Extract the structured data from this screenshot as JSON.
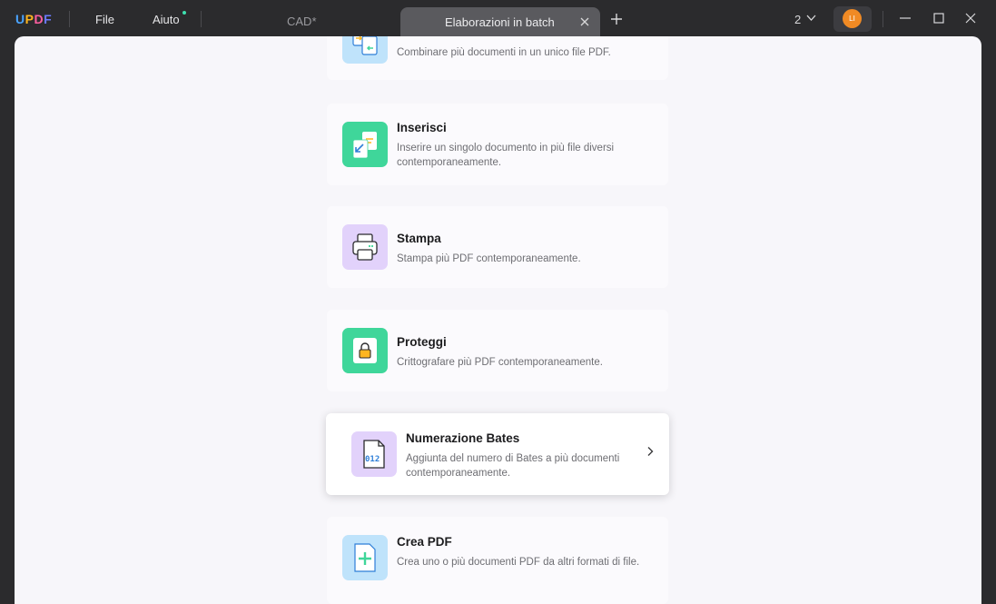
{
  "app": {
    "logo_letters": [
      "U",
      "P",
      "D",
      "F"
    ],
    "logo_colors": [
      "#4aa3ff",
      "#ffb51f",
      "#ff5fa0",
      "#6c7bff"
    ]
  },
  "menu": {
    "file_label": "File",
    "help_label": "Aiuto"
  },
  "tabs": [
    {
      "label": "CAD*",
      "active": false
    },
    {
      "label": "Elaborazioni in batch",
      "active": true
    }
  ],
  "header": {
    "window_count": "2",
    "avatar_initials": "LI"
  },
  "cards": [
    {
      "id": "combine",
      "title": "",
      "description": "Combinare più documenti in un unico file PDF.",
      "icon": "combine-icon",
      "icon_bg": "#bfe3fb"
    },
    {
      "id": "insert",
      "title": "Inserisci",
      "description": "Inserire un singolo documento in più file diversi contemporaneamente.",
      "icon": "insert-icon",
      "icon_bg": "#3fd69a"
    },
    {
      "id": "print",
      "title": "Stampa",
      "description": "Stampa più PDF contemporaneamente.",
      "icon": "printer-icon",
      "icon_bg": "#e2d2fb"
    },
    {
      "id": "protect",
      "title": "Proteggi",
      "description": "Crittografare più PDF contemporaneamente.",
      "icon": "lock-icon",
      "icon_bg": "#3fd69a"
    },
    {
      "id": "bates",
      "title": "Numerazione Bates",
      "description": "Aggiunta del numero di Bates a più documenti contemporaneamente.",
      "icon": "bates-number-icon",
      "icon_bg": "#e2d2fb",
      "highlighted": true,
      "bates_sample": "012"
    },
    {
      "id": "create",
      "title": "Crea PDF",
      "description": "Crea uno o più documenti PDF da altri formati di file.",
      "icon": "create-pdf-icon",
      "icon_bg": "#bfe3fb"
    }
  ]
}
